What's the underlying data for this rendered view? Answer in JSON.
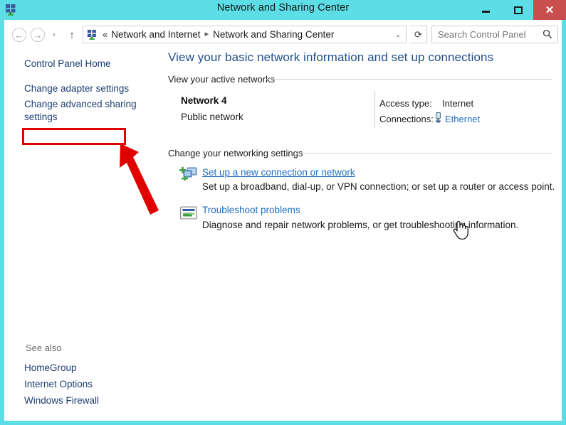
{
  "window": {
    "title": "Network and Sharing Center",
    "title_icon": "network-icon",
    "minimize_label": "–",
    "maximize_label": "",
    "close_label": "✕",
    "accent_color": "#5ddde5",
    "close_button_color": "#c94f4f"
  },
  "navbar": {
    "back_label": "←",
    "forward_label": "→",
    "recent_label": "▾",
    "up_label": "↑",
    "address_icon": "network-icon",
    "breadcrumb_prefix": "«",
    "breadcrumbs": [
      {
        "label": "Network and Internet"
      },
      {
        "label": "Network and Sharing Center"
      }
    ],
    "breadcrumb_separator": "▸",
    "dropdown_label": "⌄",
    "refresh_label": "⟳",
    "search_placeholder": "Search Control Panel",
    "search_value": "",
    "search_icon": "magnifier-icon"
  },
  "sidebar": {
    "items": [
      {
        "label": "Control Panel Home"
      },
      {
        "label": "Change adapter settings"
      },
      {
        "label": "Change advanced sharing settings"
      }
    ],
    "see_also_title": "See also",
    "see_also": [
      {
        "label": "HomeGroup"
      },
      {
        "label": "Internet Options"
      },
      {
        "label": "Windows Firewall"
      }
    ],
    "highlight_color": "#e00000",
    "link_color": "#1d3e72"
  },
  "annotation": {
    "highlight_target": "Change adapter settings",
    "arrow_color": "#e00000"
  },
  "main": {
    "heading": "View your basic network information and set up connections",
    "sections": [
      {
        "title": "View your active networks"
      },
      {
        "title": "Change your networking settings"
      }
    ],
    "active_network": {
      "name": "Network  4",
      "type": "Public network",
      "details": [
        {
          "label": "Access type:",
          "value": "Internet"
        },
        {
          "label": "Connections:",
          "value": "Ethernet",
          "icon": "ethernet-plug-icon",
          "is_link": true
        }
      ]
    },
    "tasks": [
      {
        "icon": "new-connection-icon",
        "link": "Set up a new connection or network",
        "description": "Set up a broadband, dial-up, or VPN connection; or set up a router or access point."
      },
      {
        "icon": "troubleshoot-icon",
        "link": "Troubleshoot problems",
        "description": "Diagnose and repair network problems, or get troubleshooting information."
      }
    ],
    "heading_color": "#1f4e8c",
    "link_color": "#1f6fc4"
  },
  "cursor": {
    "type": "hand-pointer-cursor",
    "over": "Set up a new connection or network"
  }
}
